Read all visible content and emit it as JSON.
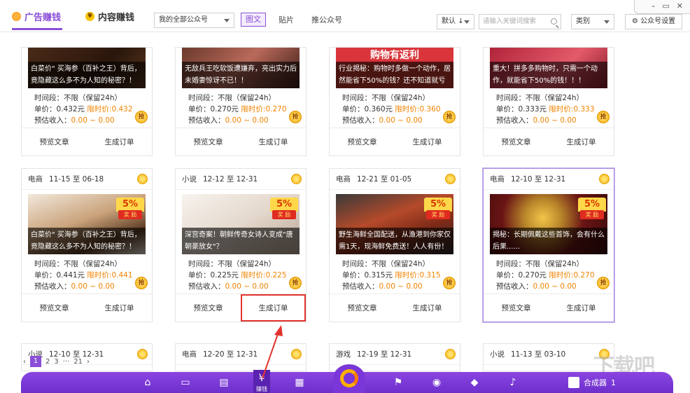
{
  "tabs": {
    "ad": "广告赚钱",
    "content": "内容赚钱"
  },
  "top": {
    "account_select": "我的全部公众号",
    "view_graphic": "图文",
    "view_paste": "贴片",
    "view_promote": "推公众号",
    "sort": "默认",
    "sort_arrow": "↓",
    "search_placeholder": "请输入关键词搜索",
    "category": "类别",
    "settings": "公众号设置"
  },
  "labels": {
    "time": "时间段：不限（保留24h）",
    "preview": "预览文章",
    "order": "生成订单",
    "grab": "抢",
    "badge_pct": "5%",
    "badge_rib": "奖 励"
  },
  "row1": [
    {
      "caption": "白菜价\" 买海参（百补之王）背后，竟隐藏这么多不为人知的秘密？！",
      "unit": "单价：0.432元",
      "limit": "限时价:0.432",
      "est_label": "预估收入：",
      "est": "0.00 ~ 0.00"
    },
    {
      "caption": "无敌兵王吃软饭遭嫌弃，亮出实力后未婚妻惊讶不已！！",
      "unit": "单价：0.270元",
      "limit": "限时价:0.270",
      "est_label": "预估收入：",
      "est": "0.00 ~ 0.00"
    },
    {
      "promo": "购物有返利",
      "caption": "行业揭秘：购物时多做一个动作，居然能省下50%的钱？还不知道就亏大",
      "unit": "单价：0.360元",
      "limit": "限时价:0.360",
      "est_label": "预估收入：",
      "est": "0.00 ~ 0.00"
    },
    {
      "caption": "重大！拼多多购物时，只需一个动作，就能省下50%的钱！！！",
      "unit": "单价：0.333元",
      "limit": "限时价:0.333",
      "est_label": "预估收入：",
      "est": "0.00 ~ 0.00"
    }
  ],
  "row2": [
    {
      "cat": "电商",
      "date": "11-15 至 06-18",
      "caption": "白菜价\" 买海参（百补之王）背后，竟隐藏这么多不为人知的秘密？！",
      "unit": "单价：0.441元",
      "limit": "限时价:0.441",
      "est_label": "预估收入：",
      "est": "0.00 ~ 0.00"
    },
    {
      "cat": "小说",
      "date": "12-12 至 12-31",
      "caption": "深宫奇案！朝鲜传奇女诗人变成\"唐朝豪放女\"？",
      "unit": "单价：0.225元",
      "limit": "限时价:0.225",
      "est_label": "预估收入：",
      "est": "0.00 ~ 0.00"
    },
    {
      "cat": "电商",
      "date": "12-21 至 01-05",
      "caption": "野生海鲜全国配送，从渔港到你家仅需1天，现海鲜免费送！人人有份！",
      "unit": "单价：0.315元",
      "limit": "限时价:0.315",
      "est_label": "预估收入：",
      "est": "0.00 ~ 0.00"
    },
    {
      "cat": "电商",
      "date": "12-10 至 12-31",
      "caption": "揭秘：长期佩戴这些首饰，会有什么后果......",
      "unit": "单价：0.270元",
      "limit": "限时价:0.270",
      "est_label": "预估收入：",
      "est": "0.00 ~ 0.00"
    }
  ],
  "row3": [
    {
      "cat": "小说",
      "date": "12-10 至 12-31"
    },
    {
      "cat": "电商",
      "date": "12-20 至 12-31"
    },
    {
      "cat": "游戏",
      "date": "12-19 至 12-31"
    },
    {
      "cat": "小说",
      "date": "11-13 至 03-10"
    }
  ],
  "pager": {
    "prev": "‹",
    "p1": "1",
    "p2": "2",
    "p3": "3",
    "dots": "···",
    "last": "21",
    "next": "›"
  },
  "bottom": {
    "active_label": "赚钱",
    "user_label": "合成器",
    "count": "1"
  },
  "watermark": "下载吧",
  "window": {
    "min": "–",
    "max": "▭",
    "close": "✕"
  }
}
